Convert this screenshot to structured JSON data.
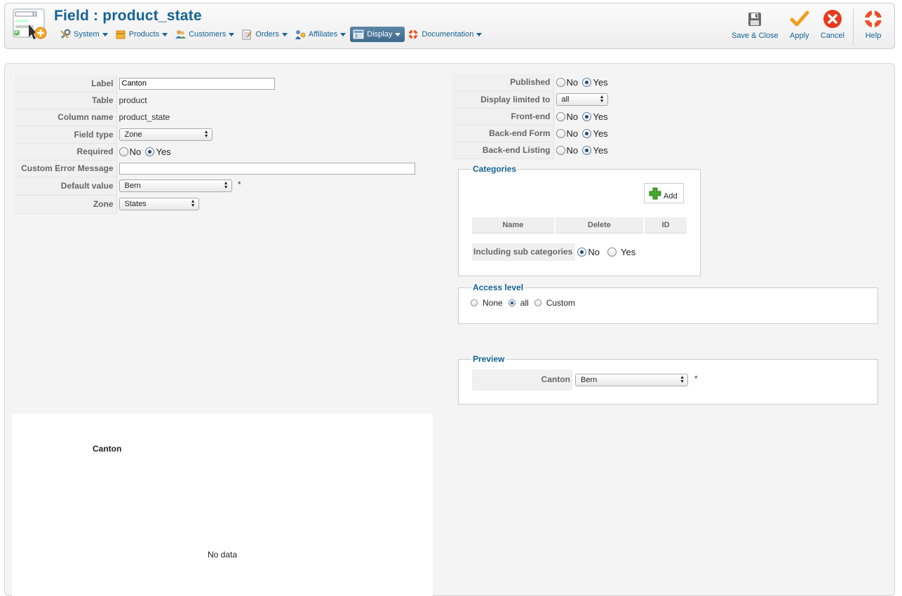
{
  "header": {
    "title": "Field : product_state",
    "menu": [
      {
        "label": "System",
        "icon": "wrench-icon"
      },
      {
        "label": "Products",
        "icon": "box-icon"
      },
      {
        "label": "Customers",
        "icon": "users-icon"
      },
      {
        "label": "Orders",
        "icon": "orders-icon"
      },
      {
        "label": "Affiliates",
        "icon": "affiliates-icon"
      },
      {
        "label": "Display",
        "icon": "display-icon",
        "active": true
      },
      {
        "label": "Documentation",
        "icon": "lifebuoy-icon"
      }
    ],
    "toolbar": {
      "save_close": "Save & Close",
      "apply": "Apply",
      "cancel": "Cancel",
      "help": "Help"
    }
  },
  "left_form": {
    "label": {
      "key": "Label",
      "value": "Canton"
    },
    "table": {
      "key": "Table",
      "value": "product"
    },
    "column_name": {
      "key": "Column name",
      "value": "product_state"
    },
    "field_type": {
      "key": "Field type",
      "value": "Zone"
    },
    "required": {
      "key": "Required",
      "no": "No",
      "yes": "Yes",
      "selected": "Yes"
    },
    "custom_error": {
      "key": "Custom Error Message",
      "value": ""
    },
    "default_value": {
      "key": "Default value",
      "value": "Bern",
      "marker": "*"
    },
    "zone": {
      "key": "Zone",
      "value": "States"
    }
  },
  "right_form": {
    "published": {
      "key": "Published",
      "no": "No",
      "yes": "Yes",
      "selected": "Yes"
    },
    "display_limited": {
      "key": "Display limited to",
      "value": "all"
    },
    "front_end": {
      "key": "Front-end",
      "no": "No",
      "yes": "Yes",
      "selected": "Yes"
    },
    "backend_form": {
      "key": "Back-end Form",
      "no": "No",
      "yes": "Yes",
      "selected": "Yes"
    },
    "backend_listing": {
      "key": "Back-end Listing",
      "no": "No",
      "yes": "Yes",
      "selected": "Yes"
    }
  },
  "categories": {
    "legend": "Categories",
    "add_label": "Add",
    "columns": [
      "Name",
      "Delete",
      "ID"
    ],
    "including_label": "Including sub categories",
    "no": "No",
    "yes": "Yes",
    "selected": "No"
  },
  "access_level": {
    "legend": "Access level",
    "options": [
      "None",
      "all",
      "Custom"
    ],
    "selected": "all"
  },
  "preview": {
    "legend": "Preview",
    "field_label": "Canton",
    "value": "Bern",
    "marker": "*"
  },
  "sample_panel": {
    "title": "Canton",
    "empty_text": "No data"
  },
  "colors": {
    "accent": "#146295",
    "active_menu": "#4a7699"
  }
}
